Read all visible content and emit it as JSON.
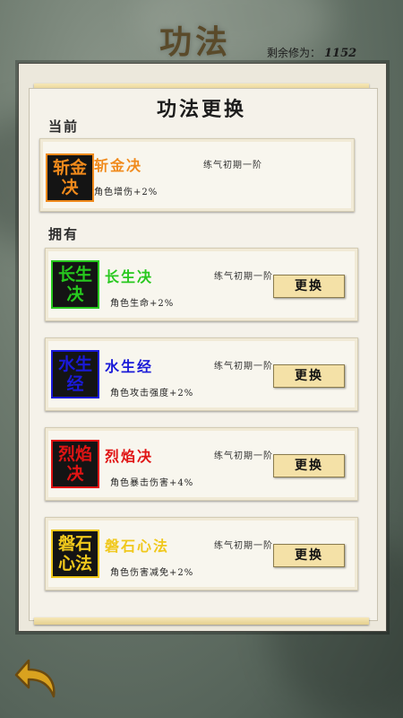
{
  "page_title": "功法",
  "remaining": {
    "label": "剩余修为：",
    "value": "1152"
  },
  "panel": {
    "title": "功法更换",
    "current_label": "当前",
    "owned_label": "拥有"
  },
  "current": {
    "badge": [
      "斩金",
      "决"
    ],
    "name": "斩金决",
    "effect": "角色增伤+2%",
    "level": "练气初期一阶",
    "color": "#f08a1c"
  },
  "owned": [
    {
      "badge": [
        "长生",
        "决"
      ],
      "name": "长生决",
      "effect": "角色生命+2%",
      "level": "练气初期一阶",
      "button": "更换",
      "color": "#27c81e"
    },
    {
      "badge": [
        "水生",
        "经"
      ],
      "name": "水生经",
      "effect": "角色攻击强度+2%",
      "level": "练气初期一阶",
      "button": "更换",
      "color": "#1a1ad8"
    },
    {
      "badge": [
        "烈焰",
        "决"
      ],
      "name": "烈焰决",
      "effect": "角色暴击伤害+4%",
      "level": "练气初期一阶",
      "button": "更换",
      "color": "#e01414"
    },
    {
      "badge": [
        "磐石",
        "心法"
      ],
      "name": "磐石心法",
      "effect": "角色伤害减免+2%",
      "level": "练气初期一阶",
      "button": "更换",
      "color": "#f0c81c"
    }
  ],
  "icons": {
    "back": "back-arrow-icon"
  }
}
